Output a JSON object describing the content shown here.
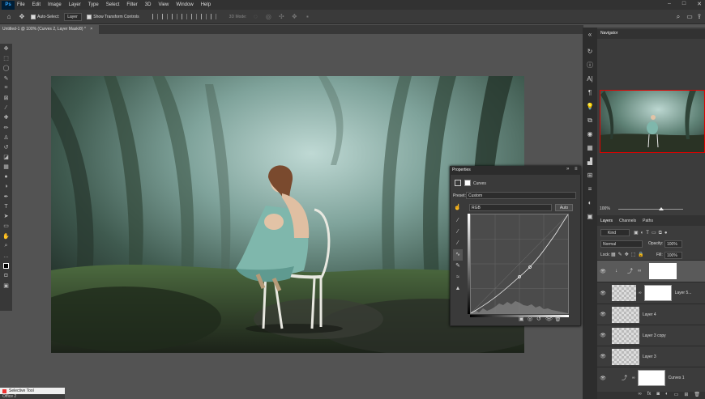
{
  "app": {
    "logo": "Ps",
    "menu": [
      "File",
      "Edit",
      "Image",
      "Layer",
      "Type",
      "Select",
      "Filter",
      "3D",
      "View",
      "Window",
      "Help"
    ]
  },
  "options": {
    "auto_select": "Auto-Select:",
    "auto_select_target": "Layer",
    "show_transform": "Show Transform Controls",
    "mode_3d": "3D Mode:"
  },
  "document": {
    "tab": "Untitled-1 @ 100% (Curves 2, Layer Mask/8) *"
  },
  "navigator": {
    "title": "Navigator",
    "zoom": "100%"
  },
  "properties": {
    "title": "Properties",
    "adjustment": "Curves",
    "preset_label": "Preset:",
    "preset_value": "Custom",
    "channel": "RGB",
    "auto_label": "Auto"
  },
  "layers": {
    "tabs": [
      "Layers",
      "Channels",
      "Paths"
    ],
    "filter": "Kind",
    "blend_mode": "Normal",
    "opacity_label": "Opacity:",
    "opacity": "100%",
    "lock_label": "Lock:",
    "fill_label": "Fill:",
    "fill": "100%",
    "items": [
      {
        "name": ""
      },
      {
        "name": "Layer 5..."
      },
      {
        "name": "Layer 4"
      },
      {
        "name": "Layer 3 copy"
      },
      {
        "name": "Layer 3"
      },
      {
        "name": "Curves 1"
      }
    ]
  },
  "bottom": {
    "tooltip": "Selective Tool",
    "status": "Office 2"
  },
  "colors": {
    "accent": "#31a8ff",
    "nav_frame": "#e00000",
    "panel_bg": "#3c3c3c"
  }
}
